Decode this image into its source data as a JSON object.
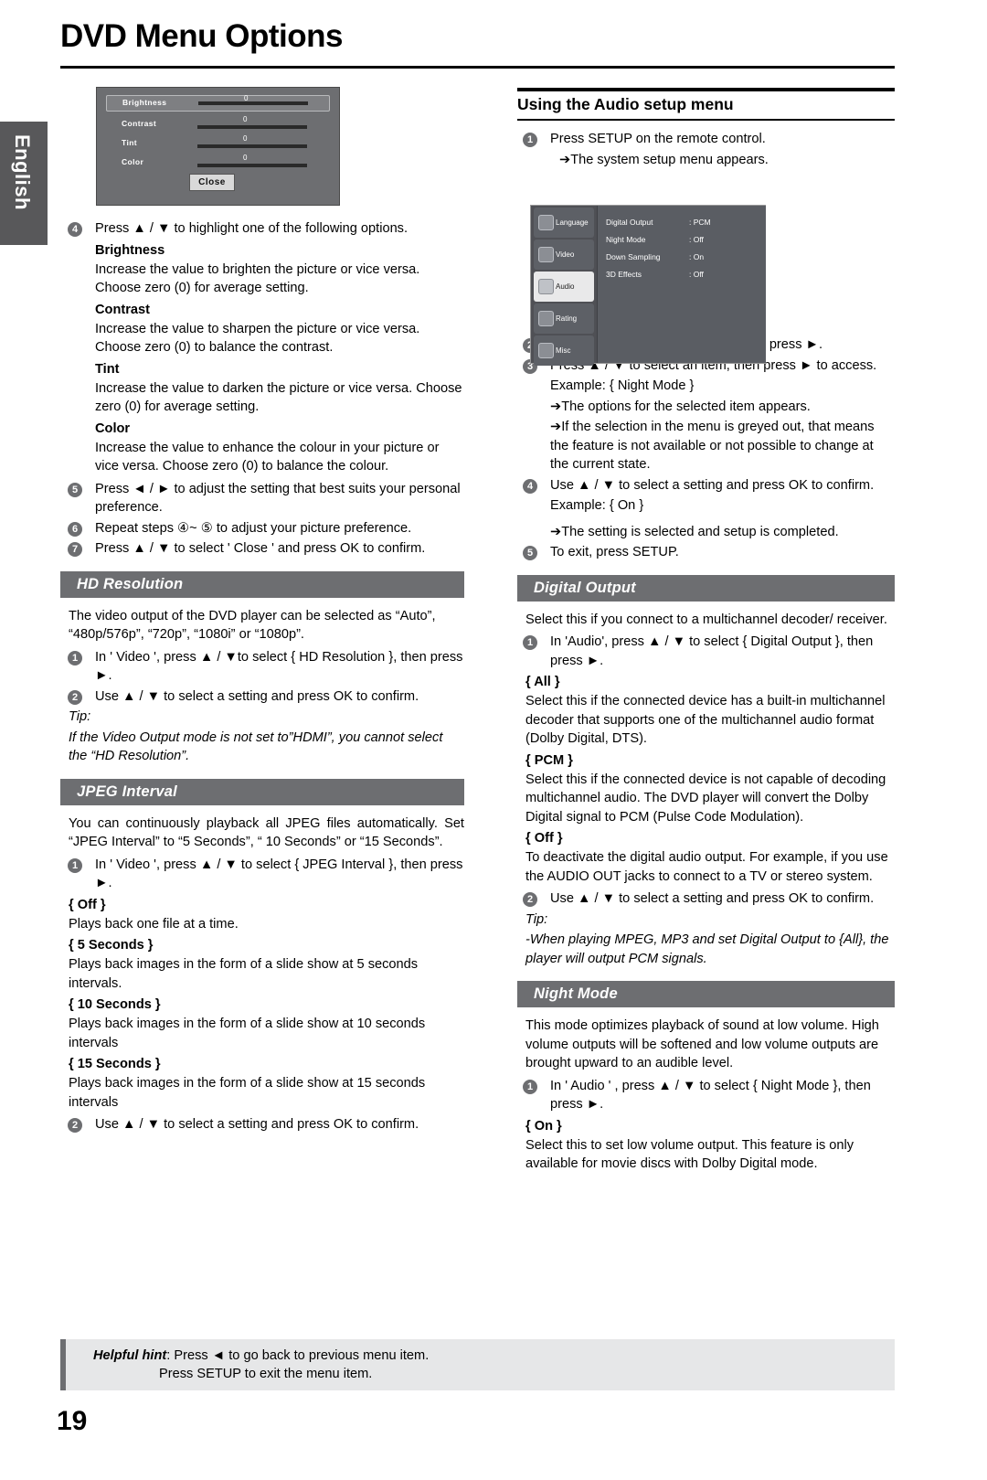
{
  "document": {
    "title": "DVD Menu Options",
    "page_number": "19",
    "side_tab": "English"
  },
  "mock_picture_menu": {
    "rows": [
      {
        "label": "Brightness",
        "value": "0"
      },
      {
        "label": "Contrast",
        "value": "0"
      },
      {
        "label": "Tint",
        "value": "0"
      },
      {
        "label": "Color",
        "value": "0"
      }
    ],
    "close_button": "Close"
  },
  "mock_setup_menu": {
    "sidebar": [
      {
        "label": "Language",
        "icon": "language-icon",
        "selected": false
      },
      {
        "label": "Video",
        "icon": "video-icon",
        "selected": false
      },
      {
        "label": "Audio",
        "icon": "audio-icon",
        "selected": true
      },
      {
        "label": "Rating",
        "icon": "rating-icon",
        "selected": false
      },
      {
        "label": "Misc",
        "icon": "misc-icon",
        "selected": false
      }
    ],
    "rows": [
      {
        "key": "Digital Output",
        "value": ": PCM"
      },
      {
        "key": "Night Mode",
        "value": ": Off"
      },
      {
        "key": "Down Sampling",
        "value": ": On"
      },
      {
        "key": "3D Effects",
        "value": ": Off"
      }
    ]
  },
  "left_column": {
    "step4": "Press ▲ / ▼ to highlight one of the following options.",
    "brightness_term": "Brightness",
    "brightness_text": "Increase the value to brighten the picture or vice versa. Choose zero (0) for average setting.",
    "contrast_term": "Contrast",
    "contrast_text": "Increase the value to sharpen the picture or vice versa.  Choose zero (0) to balance the contrast.",
    "tint_term": "Tint",
    "tint_text": "Increase the value to darken the picture or vice versa.  Choose zero (0) for average setting.",
    "color_term": "Color",
    "color_text": "Increase the value to enhance the colour in your picture or vice versa. Choose zero (0) to balance the colour.",
    "step5": "Press ◄ /  ► to adjust the setting that best suits your personal preference.",
    "step6": "Repeat steps ④~ ⑤ to adjust your picture preference.",
    "step7": "Press ▲ / ▼ to select  ' Close '  and press OK to confirm.",
    "hd_resolution": {
      "heading": "HD Resolution",
      "intro": "The video output of the DVD player can be selected as “Auto”, “480p/576p”, “720p”, “1080i” or “1080p”.",
      "step1": "In ' Video ', press ▲ / ▼to select  { HD Resolution }, then press ►.",
      "step2": "Use ▲ / ▼ to select a setting and press OK to confirm.",
      "tip_label": "Tip:",
      "tip_text": "If the Video Output mode is not set to”HDMI”, you cannot select the “HD Resolution”."
    },
    "jpeg_interval": {
      "heading": "JPEG Interval",
      "intro": "You can continuously playback all JPEG files automatically. Set “JPEG Interval” to “5 Seconds”, “ 10 Seconds” or “15 Seconds”.",
      "step1": "In ' Video ', press ▲ / ▼ to select  { JPEG Interval }, then press  ►.",
      "opt_off": "{ Off }",
      "opt_off_text": "Plays back one file at a time.",
      "opt_5": "{ 5 Seconds }",
      "opt_5_text": "Plays back images in the form of a slide show at 5 seconds intervals.",
      "opt_10": "{ 10 Seconds }",
      "opt_10_text": "Plays back images in the form of a slide show at 10 seconds intervals",
      "opt_15": "{ 15 Seconds }",
      "opt_15_text": "Plays back images in the form of a slide show at 15 seconds intervals",
      "step2": "Use ▲ / ▼ to select a setting and press OK to confirm."
    }
  },
  "right_column": {
    "heading": "Using the Audio setup menu",
    "step1": "Press SETUP on the remote control.",
    "step1_arrow": "➔The system setup menu appears.",
    "step2": "Press ▲ / ▼ to select { Audio }, then press ►.",
    "step3": "Press ▲ / ▼ to select an item, then press ► to access.",
    "step3_example": "Example: { Night Mode }",
    "step3_arrow1": "➔The options for the selected item appears.",
    "step3_arrow2": "➔If the selection in the menu is greyed out, that means the feature is not available or not possible to change at the current state.",
    "step4": "Use ▲ / ▼ to select a setting and press OK to confirm.",
    "step4_example": "Example: { On }",
    "step4_arrow": "➔The setting is selected and setup is completed.",
    "step5": "To exit, press SETUP.",
    "digital_output": {
      "heading": "Digital Output",
      "intro": "Select this if you connect to a multichannel decoder/ receiver.",
      "step1": "In 'Audio', press ▲ / ▼ to select { Digital Output }, then press ►.",
      "opt_all": "{ All }",
      "opt_all_text": "Select this if the connected device has a built-in multichannel decoder that supports one of the multichannel audio format (Dolby Digital, DTS).",
      "opt_pcm": "{ PCM }",
      "opt_pcm_text": "Select this if the connected device is not capable of decoding multichannel audio. The DVD player will convert the Dolby Digital signal to PCM (Pulse Code Modulation).",
      "opt_off": "{ Off }",
      "opt_off_text": "To deactivate the digital audio output. For example, if you use the AUDIO OUT jacks to connect to a TV or stereo system.",
      "step2": "Use ▲ / ▼ to select a setting  and press OK to confirm.",
      "tip_label": "Tip:",
      "tip_text": "-When playing MPEG, MP3 and set Digital Output to {All}, the player will output PCM signals."
    },
    "night_mode": {
      "heading": "Night Mode",
      "intro": "This mode optimizes playback of sound at low volume. High volume outputs will be softened and low volume outputs are brought upward to an audible level.",
      "step1": "In  '  Audio  ' , press ▲ / ▼ to select { Night Mode }, then press ►.",
      "opt_on": "{ On }",
      "opt_on_text": "Select this to set low volume output. This feature is only available for movie discs with Dolby Digital mode."
    }
  },
  "footer": {
    "hint_label": "Helpful hint",
    "hint_line1": ":  Press ◄ to go back to previous menu item.",
    "hint_line2": "Press SETUP to exit the menu item."
  }
}
